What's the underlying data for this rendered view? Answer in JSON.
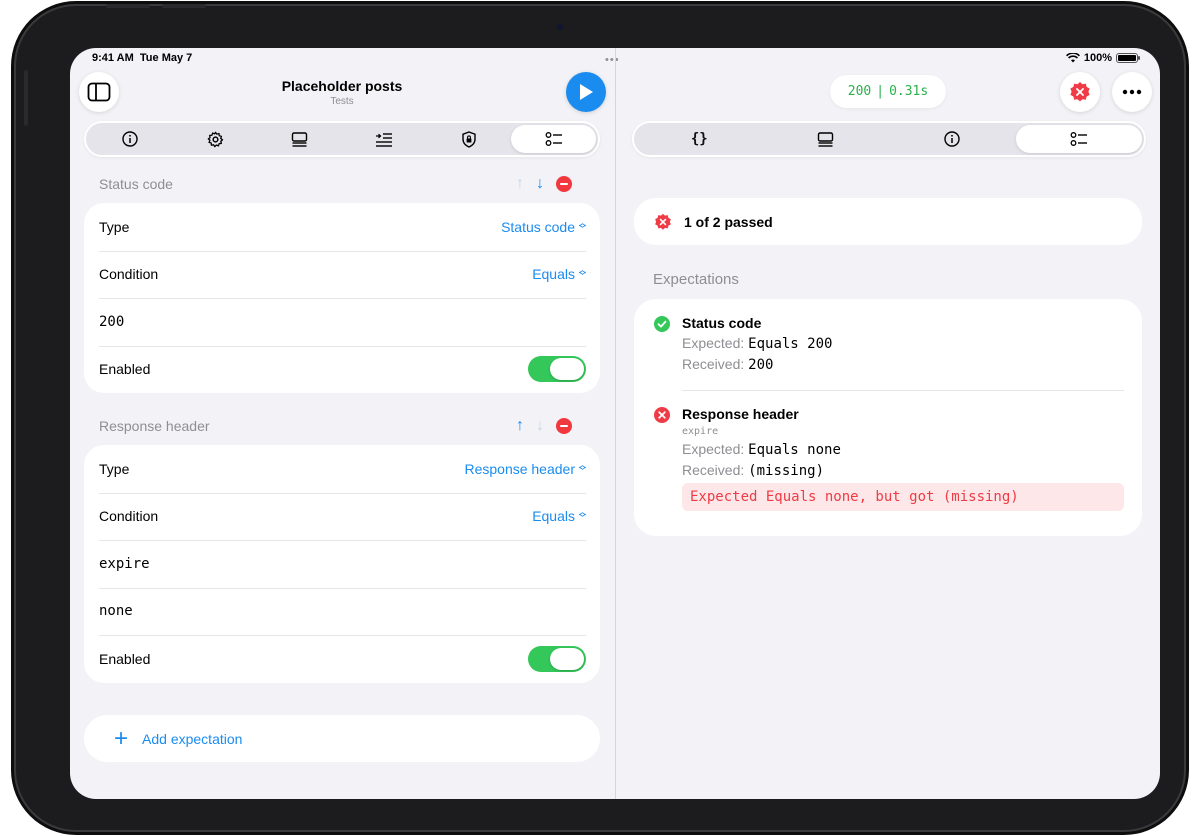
{
  "status_bar": {
    "time": "9:41 AM",
    "date": "Tue May 7",
    "battery": "100%",
    "battery_level": 1.0
  },
  "multitask": "•••",
  "left": {
    "title": "Placeholder posts",
    "subtitle": "Tests",
    "tabs": [
      {
        "icon": "info-icon",
        "active": false
      },
      {
        "icon": "gear-icon",
        "active": false
      },
      {
        "icon": "body-icon",
        "active": false
      },
      {
        "icon": "headers-icon",
        "active": false
      },
      {
        "icon": "shield-icon",
        "active": false
      },
      {
        "icon": "checklist-icon",
        "active": true
      }
    ],
    "expectations": [
      {
        "header": "Status code",
        "up_enabled": false,
        "down_enabled": true,
        "type_label": "Type",
        "type_value": "Status code",
        "condition_label": "Condition",
        "condition_value": "Equals",
        "fields": [
          "200"
        ],
        "enabled_label": "Enabled",
        "enabled": true
      },
      {
        "header": "Response header",
        "up_enabled": true,
        "down_enabled": false,
        "type_label": "Type",
        "type_value": "Response header",
        "condition_label": "Condition",
        "condition_value": "Equals",
        "fields": [
          "expire",
          "none"
        ],
        "enabled_label": "Enabled",
        "enabled": true
      }
    ],
    "add_label": "Add expectation"
  },
  "right": {
    "status_code": "200",
    "separator": "|",
    "duration": "0.31s",
    "tabs": [
      {
        "icon": "braces-icon",
        "active": false
      },
      {
        "icon": "body-icon",
        "active": false
      },
      {
        "icon": "info-icon",
        "active": false
      },
      {
        "icon": "checklist-icon",
        "active": true
      }
    ],
    "summary": "1 of 2 passed",
    "expectations_header": "Expectations",
    "results": [
      {
        "title": "Status code",
        "passed": true,
        "expected_label": "Expected:",
        "expected_value": "Equals 200",
        "received_label": "Received:",
        "received_value": "200"
      },
      {
        "title": "Response header",
        "passed": false,
        "key": "expire",
        "expected_label": "Expected:",
        "expected_value": "Equals none",
        "received_label": "Received:",
        "received_value": "(missing)",
        "error": "Expected Equals none, but got (missing)"
      }
    ]
  },
  "colors": {
    "accent": "#1a8cf0",
    "success": "#34c759",
    "error": "#ef3b45",
    "background": "#f2f2f7"
  }
}
